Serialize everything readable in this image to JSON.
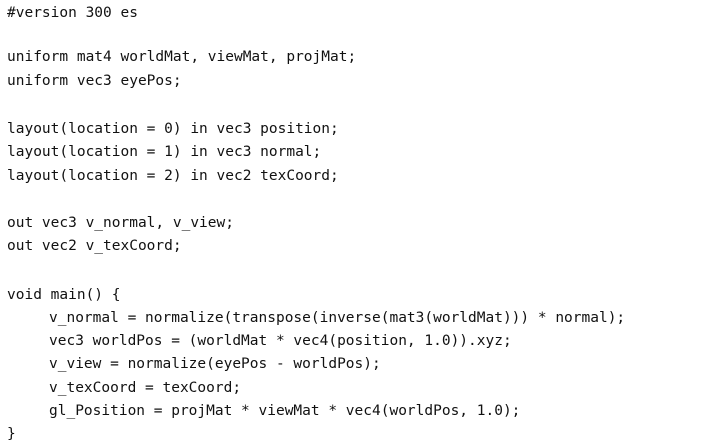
{
  "code": {
    "lines": [
      "#version 300 es",
      "",
      "uniform mat4 worldMat, viewMat, projMat;",
      "uniform vec3 eyePos;",
      "",
      "layout(location = 0) in vec3 position;",
      "layout(location = 1) in vec3 normal;",
      "layout(location = 2) in vec2 texCoord;",
      "",
      "out vec3 v_normal, v_view;",
      "out vec2 v_texCoord;",
      "",
      "void main() {",
      "v_normal = normalize(transpose(inverse(mat3(worldMat))) * normal);",
      "vec3 worldPos = (worldMat * vec4(position, 1.0)).xyz;",
      "v_view = normalize(eyePos - worldPos);",
      "v_texCoord = texCoord;",
      "gl_Position = projMat * viewMat * vec4(worldPos, 1.0);",
      "}"
    ]
  }
}
